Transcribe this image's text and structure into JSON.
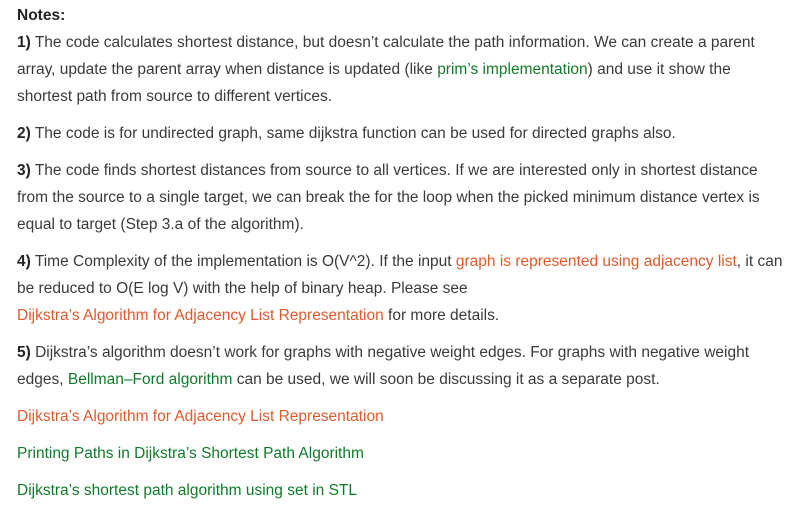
{
  "notes": {
    "title": "Notes:",
    "items": [
      {
        "number": "1)",
        "before": " The code calculates shortest distance, but doesn’t calculate the path information. We can create a parent array, update the parent array when distance is updated (like ",
        "link": "prim’s implementation",
        "after": ") and use it show the shortest path from source to different vertices."
      },
      {
        "number": "2)",
        "text": " The code is for undirected graph, same dijkstra function can be used for directed graphs also."
      },
      {
        "number": "3)",
        "text": " The code finds shortest distances from source to all vertices. If we are interested only in shortest distance from the source to a single target, we can break the for the loop when the picked minimum distance vertex is equal to target (Step 3.a of the algorithm)."
      },
      {
        "number": "4)",
        "before": " Time Complexity of the implementation is O(V^2). If the input ",
        "link1": "graph is represented using adjacency list",
        "middle": ", it can be reduced to O(E log V) with the help of binary heap. Please see ",
        "link2": "Dijkstra’s Algorithm for Adjacency List Representation",
        "after": " for more details."
      },
      {
        "number": "5)",
        "before": " Dijkstra’s algorithm doesn’t work for graphs with negative weight edges. For graphs with negative weight edges, ",
        "link": "Bellman–Ford algorithm",
        "after": " can be used, we will soon be discussing it as a separate post."
      }
    ]
  },
  "related_links": [
    "Dijkstra’s Algorithm for Adjacency List Representation",
    "Printing Paths in Dijkstra’s Shortest Path Algorithm",
    "Dijkstra’s shortest path algorithm using set in STL"
  ],
  "colors": {
    "text": "#3a3a3a",
    "link_green": "#117a2a",
    "link_orange": "#e05a2b"
  }
}
